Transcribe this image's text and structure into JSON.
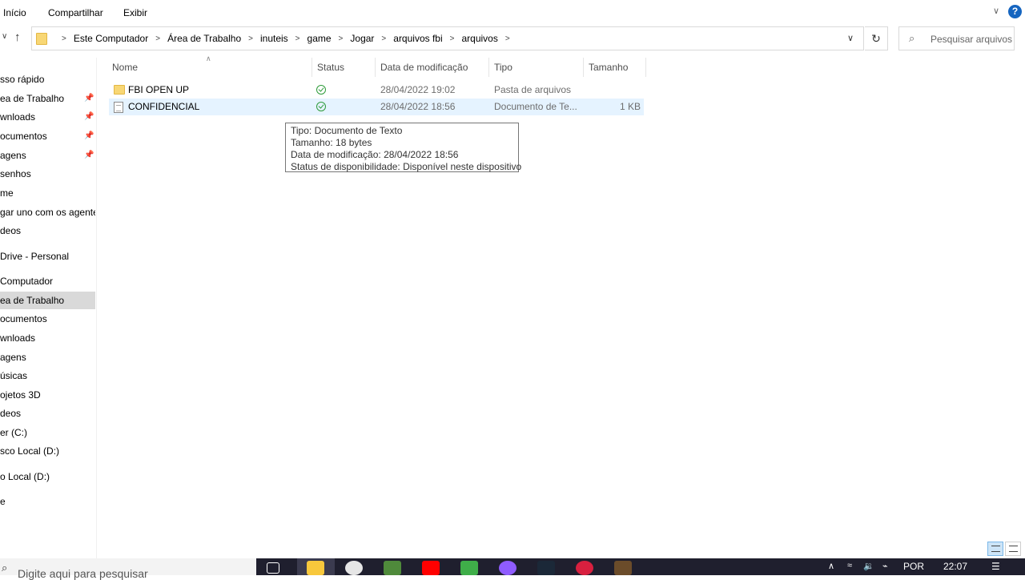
{
  "ribbon": {
    "tabs": [
      "Início",
      "Compartilhar",
      "Exibir"
    ],
    "help_label": "?"
  },
  "address": {
    "breadcrumbs": [
      "Este Computador",
      "Área de Trabalho",
      "inuteis",
      "game",
      "Jogar",
      "arquivos fbi",
      "arquivos"
    ],
    "search_placeholder": "Pesquisar arquivos"
  },
  "sidebar": {
    "items": [
      {
        "label": "sso rápido",
        "pinned": false
      },
      {
        "label": "ea de Trabalho",
        "pinned": true
      },
      {
        "label": "wnloads",
        "pinned": true
      },
      {
        "label": "ocumentos",
        "pinned": true
      },
      {
        "label": "agens",
        "pinned": true
      },
      {
        "label": "senhos",
        "pinned": false
      },
      {
        "label": "me",
        "pinned": false
      },
      {
        "label": "gar uno com os agentes",
        "pinned": false
      },
      {
        "label": "deos",
        "pinned": false
      },
      {
        "label": "Drive - Personal",
        "pinned": false
      },
      {
        "label": " Computador",
        "pinned": false
      },
      {
        "label": "ea de Trabalho",
        "pinned": false
      },
      {
        "label": "ocumentos",
        "pinned": false
      },
      {
        "label": "wnloads",
        "pinned": false
      },
      {
        "label": "agens",
        "pinned": false
      },
      {
        "label": "úsicas",
        "pinned": false
      },
      {
        "label": "ojetos 3D",
        "pinned": false
      },
      {
        "label": "deos",
        "pinned": false
      },
      {
        "label": "er (C:)",
        "pinned": false
      },
      {
        "label": "sco Local (D:)",
        "pinned": false
      },
      {
        "label": "o Local (D:)",
        "pinned": false
      },
      {
        "label": "e",
        "pinned": false
      }
    ],
    "selected_index": 11
  },
  "columns": [
    "Nome",
    "Status",
    "Data de modificação",
    "Tipo",
    "Tamanho"
  ],
  "files": [
    {
      "name": "FBI OPEN UP",
      "kind": "folder",
      "status": "available",
      "date": "28/04/2022 19:02",
      "type": "Pasta de arquivos",
      "size": ""
    },
    {
      "name": "CONFIDENCIAL",
      "kind": "text-document",
      "status": "available",
      "date": "28/04/2022 18:56",
      "type": "Documento de Te...",
      "size": "1 KB"
    }
  ],
  "selected_file_index": 1,
  "tooltip": {
    "lines": [
      "Tipo: Documento de Texto",
      "Tamanho: 18 bytes",
      "Data de modificação: 28/04/2022 18:56",
      "Status de disponibilidade: Disponível neste dispositivo"
    ]
  },
  "taskbar": {
    "search_placeholder": "Digite aqui para pesquisar",
    "apps": [
      {
        "name": "task-view-icon",
        "color": "#ffffff"
      },
      {
        "name": "file-explorer-icon",
        "color": "#f8c83c"
      },
      {
        "name": "obs-icon",
        "color": "#e6e6e6"
      },
      {
        "name": "minecraft-icon",
        "color": "#4f8a3b"
      },
      {
        "name": "youtube-icon",
        "color": "#ff0000"
      },
      {
        "name": "green-app-icon",
        "color": "#3fae49"
      },
      {
        "name": "discord-like-icon",
        "color": "#8f5cff"
      },
      {
        "name": "steam-icon",
        "color": "#1b2838"
      },
      {
        "name": "opera-icon",
        "color": "#d8203f"
      },
      {
        "name": "game-icon",
        "color": "#6b4c2a"
      }
    ],
    "language": "POR",
    "time": "22:07"
  }
}
